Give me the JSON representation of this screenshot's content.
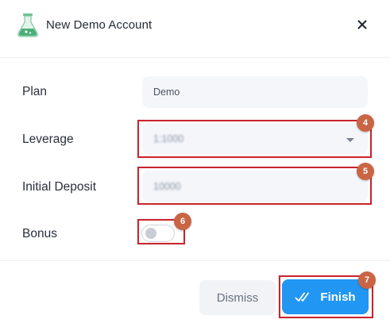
{
  "header": {
    "title": "New Demo Account",
    "icon": "flask-icon",
    "close_icon": "close-icon"
  },
  "form": {
    "plan": {
      "label": "Plan",
      "value": "Demo"
    },
    "leverage": {
      "label": "Leverage",
      "value": "1:1000"
    },
    "initial_deposit": {
      "label": "Initial Deposit",
      "value": "10000"
    },
    "bonus": {
      "label": "Bonus",
      "enabled": false
    }
  },
  "footer": {
    "dismiss_label": "Dismiss",
    "finish_label": "Finish"
  },
  "annotations": {
    "leverage_step": "4",
    "deposit_step": "5",
    "bonus_step": "6",
    "finish_step": "7"
  },
  "colors": {
    "primary": "#2196f3",
    "highlight": "#c9252d",
    "badge": "#c96545",
    "flask_green": "#4caf7a"
  }
}
